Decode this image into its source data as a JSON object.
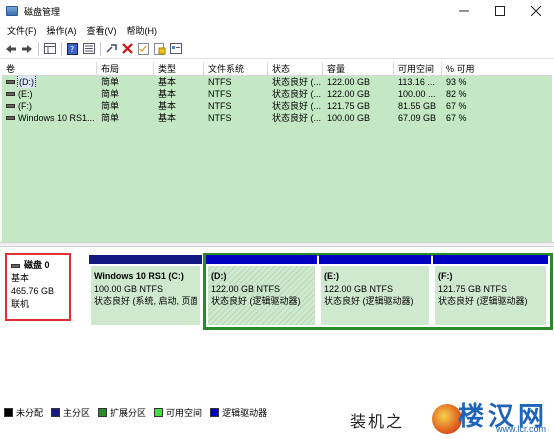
{
  "window": {
    "title": "磁盘管理",
    "min_icon": "minimize-icon",
    "max_icon": "maximize-icon",
    "close_icon": "close-icon"
  },
  "menu": [
    "文件(F)",
    "操作(A)",
    "查看(V)",
    "帮助(H)"
  ],
  "toolbar": {
    "icons": [
      "back-icon",
      "forward-icon",
      "grid-icon",
      "help-icon",
      "list-icon",
      "connect-icon",
      "delete-icon",
      "checklist-icon",
      "folder-icon",
      "properties-icon"
    ]
  },
  "table": {
    "headers": [
      "卷",
      "布局",
      "类型",
      "文件系统",
      "状态",
      "容量",
      "可用空间",
      "% 可用"
    ],
    "rows": [
      [
        "(D:)",
        "简单",
        "基本",
        "NTFS",
        "状态良好 (...",
        "122.00 GB",
        "113.16 ...",
        "93 %"
      ],
      [
        "(E:)",
        "简单",
        "基本",
        "NTFS",
        "状态良好 (...",
        "122.00 GB",
        "100.00 ...",
        "82 %"
      ],
      [
        "(F:)",
        "简单",
        "基本",
        "NTFS",
        "状态良好 (...",
        "121.75 GB",
        "81.55 GB",
        "67 %"
      ],
      [
        "Windows 10 RS1...",
        "简单",
        "基本",
        "NTFS",
        "状态良好 (...",
        "100.00 GB",
        "67.09 GB",
        "67 %"
      ]
    ]
  },
  "disk": {
    "name": "磁盘 0",
    "type": "基本",
    "size": "465.76 GB",
    "status": "联机"
  },
  "partitions": [
    {
      "title": "Windows 10 RS1  (C:)",
      "size": "100.00 GB NTFS",
      "status": "状态良好 (系统, 启动, 页面"
    },
    {
      "title": "(D:)",
      "size": "122.00 GB NTFS",
      "status": "状态良好 (逻辑驱动器)"
    },
    {
      "title": "(E:)",
      "size": "122.00 GB NTFS",
      "status": "状态良好 (逻辑驱动器)"
    },
    {
      "title": "(F:)",
      "size": "121.75 GB NTFS",
      "status": "状态良好 (逻辑驱动器)"
    }
  ],
  "legend": [
    {
      "label": "未分配",
      "color": "#000000"
    },
    {
      "label": "主分区",
      "color": "#1a1a80"
    },
    {
      "label": "扩展分区",
      "color": "#2a8a2a"
    },
    {
      "label": "可用空间",
      "color": "#44dd44"
    },
    {
      "label": "逻辑驱动器",
      "color": "#0000c0"
    }
  ],
  "watermark": {
    "left_text": "装机之",
    "brand": "楼汉网",
    "url": "www.lcr.com"
  }
}
